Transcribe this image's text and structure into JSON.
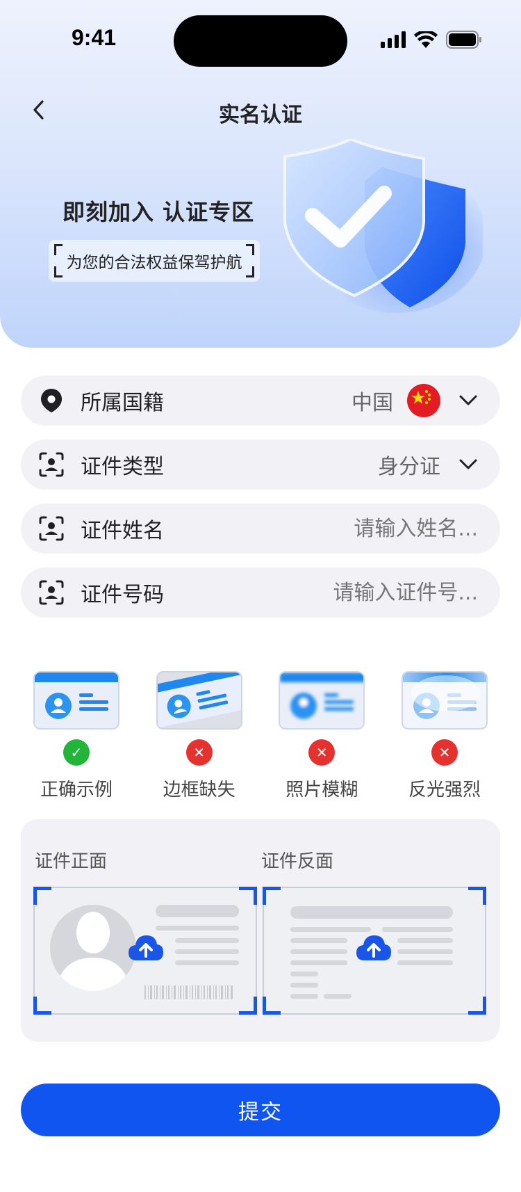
{
  "status_bar": {
    "time": "9:41"
  },
  "nav": {
    "title": "实名认证"
  },
  "hero": {
    "title": "即刻加入 认证专区",
    "tagline": "为您的合法权益保驾护航"
  },
  "form": {
    "nationality": {
      "label": "所属国籍",
      "value": "中国",
      "flag_icon": "china-flag-icon"
    },
    "id_type": {
      "label": "证件类型",
      "value": "身分证"
    },
    "id_name": {
      "label": "证件姓名",
      "placeholder": "请输入姓名..."
    },
    "id_number": {
      "label": "证件号码",
      "placeholder": "请输入证件号..."
    }
  },
  "examples": [
    {
      "label": "正确示例",
      "status": "correct"
    },
    {
      "label": "边框缺失",
      "status": "wrong"
    },
    {
      "label": "照片模糊",
      "status": "wrong"
    },
    {
      "label": "反光强烈",
      "status": "wrong"
    }
  ],
  "upload": {
    "front_label": "证件正面",
    "back_label": "证件反面"
  },
  "submit_label": "提交",
  "colors": {
    "primary": "#1055f0",
    "ok": "#22b538",
    "error": "#e5322f",
    "field_bg": "#f1f1f6"
  }
}
